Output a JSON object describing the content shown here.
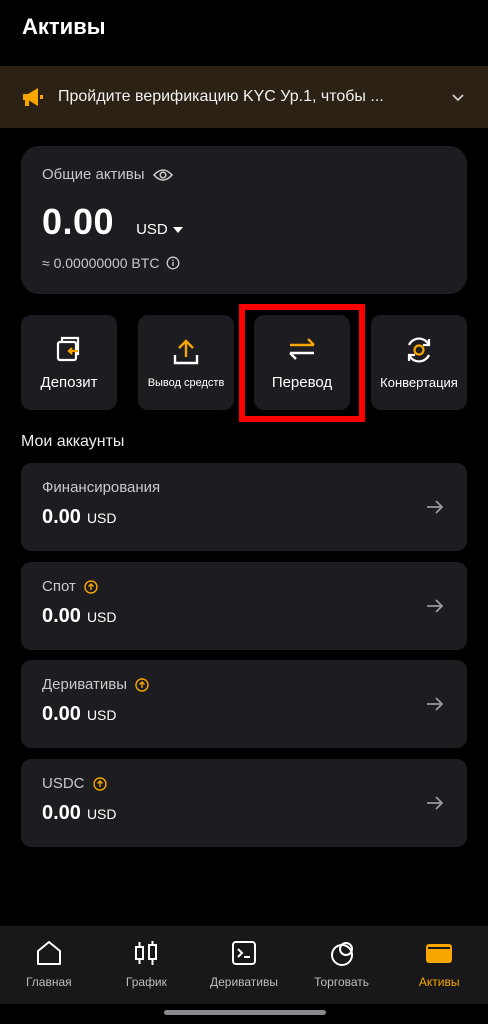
{
  "page": {
    "title": "Активы"
  },
  "kyc_banner": {
    "text": "Пройдите верификацию KYC Ур.1, чтобы ..."
  },
  "total": {
    "label": "Общие активы",
    "amount": "0.00",
    "currency": "USD",
    "btc_equiv": "≈ 0.00000000 BTC"
  },
  "actions": [
    {
      "label": "Депозит",
      "icon": "deposit-icon"
    },
    {
      "label": "Вывод средств",
      "icon": "upload-icon"
    },
    {
      "label": "Перевод",
      "icon": "transfer-icon"
    },
    {
      "label": "Конвертация",
      "icon": "convert-icon"
    }
  ],
  "accounts_section": {
    "title": "Мои аккаунты"
  },
  "accounts": [
    {
      "name": "Финансирования",
      "amount": "0.00",
      "currency": "USD"
    },
    {
      "name": "Спот",
      "amount": "0.00",
      "currency": "USD"
    },
    {
      "name": "Деривативы",
      "amount": "0.00",
      "currency": "USD"
    },
    {
      "name": "USDC",
      "amount": "0.00",
      "currency": "USD"
    }
  ],
  "nav": [
    {
      "label": "Главная",
      "icon": "home-icon"
    },
    {
      "label": "График",
      "icon": "candlestick-icon"
    },
    {
      "label": "Деривативы",
      "icon": "terminal-icon"
    },
    {
      "label": "Торговать",
      "icon": "trade-icon"
    },
    {
      "label": "Активы",
      "icon": "wallet-icon"
    }
  ],
  "colors": {
    "accent": "#f7a600",
    "card": "#1d1d21",
    "highlight": "#ff0000",
    "banner": "#2b2114"
  }
}
